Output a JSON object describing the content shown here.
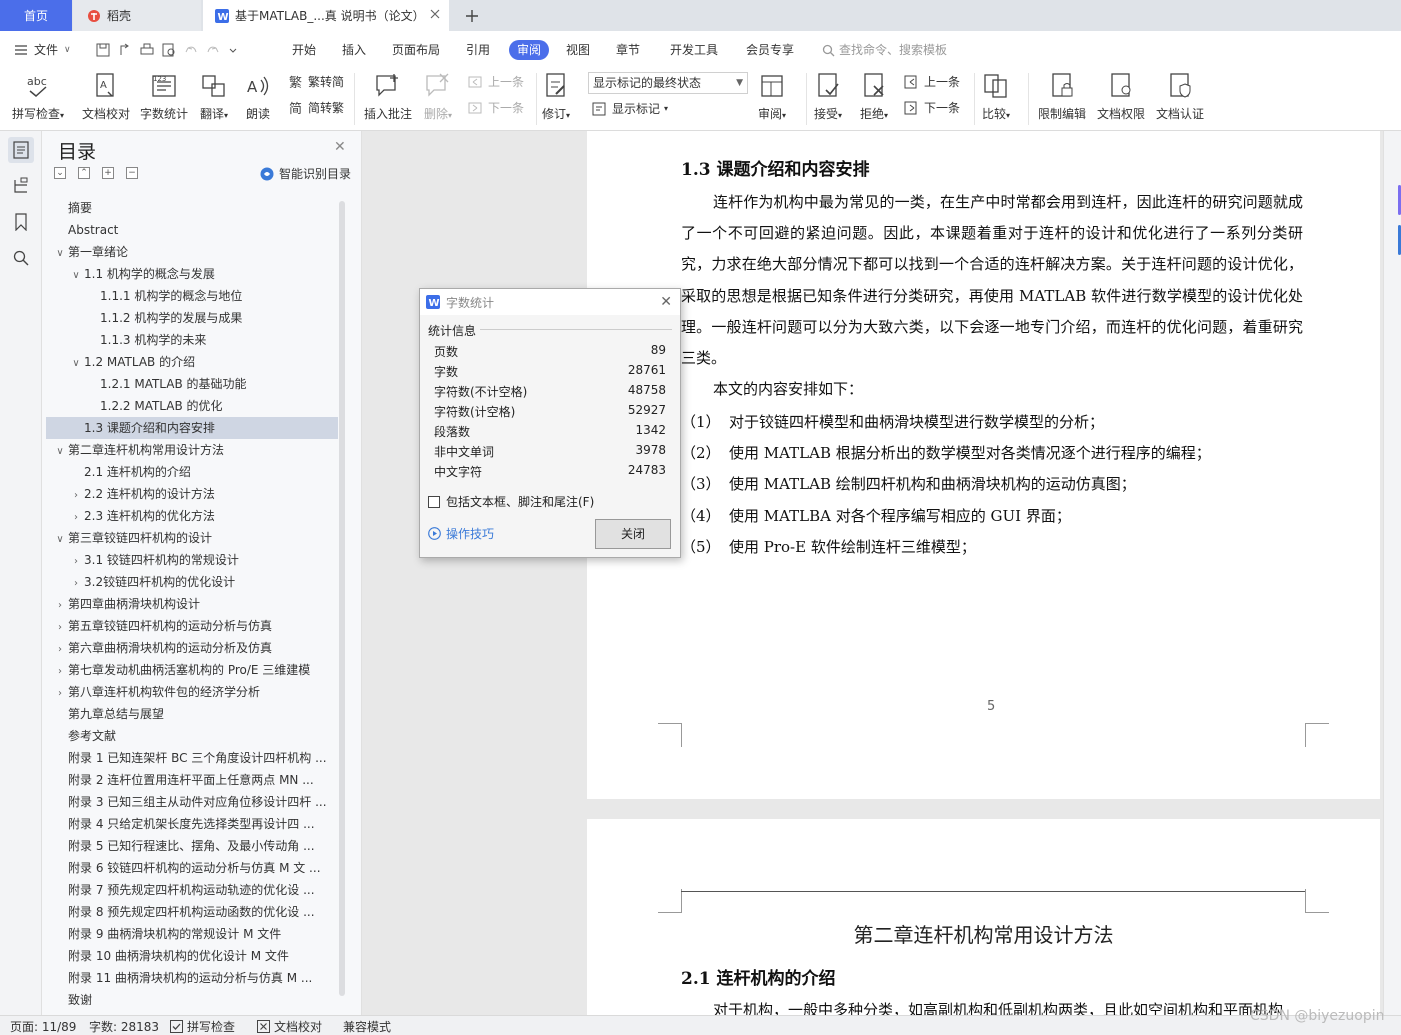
{
  "tabs": {
    "home": "首页",
    "daoke": "稻壳",
    "doc": "基于MATLAB_...真 说明书（论文）"
  },
  "menu": {
    "file": "文件",
    "items": [
      "开始",
      "插入",
      "页面布局",
      "引用",
      "审阅",
      "视图",
      "章节",
      "开发工具",
      "会员专享"
    ],
    "search": "查找命令、搜索模板"
  },
  "ribbon": {
    "spell": "拼写检查",
    "proof": "文档校对",
    "wordcount": "字数统计",
    "translate": "翻译",
    "read": "朗读",
    "trad": "繁转简",
    "simp": "简转繁",
    "insert_comment": "插入批注",
    "delete": "删除",
    "prev": "上一条",
    "next": "下一条",
    "revise": "修订",
    "markup_select": "显示标记的最终状态",
    "show_markup": "显示标记",
    "review": "审阅",
    "accept": "接受",
    "reject": "拒绝",
    "prev2": "上一条",
    "next2": "下一条",
    "compare": "比较",
    "restrict": "限制编辑",
    "rights": "文档权限",
    "auth": "文档认证"
  },
  "toc": {
    "title": "目录",
    "smart": "智能识别目录",
    "items": [
      {
        "text": "摘要",
        "level": 0,
        "tw": ""
      },
      {
        "text": "Abstract",
        "level": 0,
        "tw": ""
      },
      {
        "text": "第一章绪论",
        "level": 0,
        "tw": "v"
      },
      {
        "text": "1.1  机构学的概念与发展",
        "level": 1,
        "tw": "v"
      },
      {
        "text": "1.1.1 机构学的概念与地位",
        "level": 2,
        "tw": ""
      },
      {
        "text": "1.1.2  机构学的发展与成果",
        "level": 2,
        "tw": ""
      },
      {
        "text": "1.1.3  机构学的未来",
        "level": 2,
        "tw": ""
      },
      {
        "text": "1.2 MATLAB 的介绍",
        "level": 1,
        "tw": "v"
      },
      {
        "text": "1.2.1 MATLAB 的基础功能",
        "level": 2,
        "tw": ""
      },
      {
        "text": "1.2.2 MATLAB 的优化",
        "level": 2,
        "tw": ""
      },
      {
        "text": "1.3  课题介绍和内容安排",
        "level": 1,
        "tw": "",
        "sel": true
      },
      {
        "text": "第二章连杆机构常用设计方法",
        "level": 0,
        "tw": "v"
      },
      {
        "text": "2.1  连杆机构的介绍",
        "level": 1,
        "tw": ""
      },
      {
        "text": "2.2 连杆机构的设计方法",
        "level": 1,
        "tw": ">"
      },
      {
        "text": "2.3  连杆机构的优化方法",
        "level": 1,
        "tw": ">"
      },
      {
        "text": "第三章铰链四杆机构的设计",
        "level": 0,
        "tw": "v"
      },
      {
        "text": "3.1  铰链四杆机构的常规设计",
        "level": 1,
        "tw": ">"
      },
      {
        "text": "3.2铰链四杆机构的优化设计",
        "level": 1,
        "tw": ">"
      },
      {
        "text": "第四章曲柄滑块机构设计",
        "level": 0,
        "tw": ">"
      },
      {
        "text": "第五章铰链四杆机构的运动分析与仿真",
        "level": 0,
        "tw": ">"
      },
      {
        "text": "第六章曲柄滑块机构的运动分析及仿真",
        "level": 0,
        "tw": ">"
      },
      {
        "text": "第七章发动机曲柄活塞机构的 Pro/E 三维建模",
        "level": 0,
        "tw": ">"
      },
      {
        "text": "第八章连杆机构软件包的经济学分析",
        "level": 0,
        "tw": ">"
      },
      {
        "text": "第九章总结与展望",
        "level": 0,
        "tw": ""
      },
      {
        "text": "参考文献",
        "level": 0,
        "tw": ""
      },
      {
        "text": "附录 1 已知连架杆 BC 三个角度设计四杆机构 ...",
        "level": 0,
        "tw": ""
      },
      {
        "text": "附录 2  连杆位置用连杆平面上任意两点 MN ...",
        "level": 0,
        "tw": ""
      },
      {
        "text": "附录 3 已知三组主从动件对应角位移设计四杆 ...",
        "level": 0,
        "tw": ""
      },
      {
        "text": "附录 4  只给定机架长度先选择类型再设计四 ...",
        "level": 0,
        "tw": ""
      },
      {
        "text": "附录 5  已知行程速比、摆角、及最小传动角 ...",
        "level": 0,
        "tw": ""
      },
      {
        "text": "附录 6  铰链四杆机构的运动分析与仿真 M 文 ...",
        "level": 0,
        "tw": ""
      },
      {
        "text": "附录 7  预先规定四杆机构运动轨迹的优化设 ...",
        "level": 0,
        "tw": ""
      },
      {
        "text": "附录 8  预先规定四杆机构运动函数的优化设 ...",
        "level": 0,
        "tw": ""
      },
      {
        "text": "附录 9  曲柄滑块机构的常规设计 M 文件",
        "level": 0,
        "tw": ""
      },
      {
        "text": "附录 10  曲柄滑块机构的优化设计 M 文件",
        "level": 0,
        "tw": ""
      },
      {
        "text": "附录 11  曲柄滑块机构的运动分析与仿真 M ...",
        "level": 0,
        "tw": ""
      },
      {
        "text": "致谢",
        "level": 0,
        "tw": ""
      }
    ]
  },
  "doc": {
    "h13": "1.3  课题介绍和内容安排",
    "p1": "连杆作为机构中最为常见的一类，在生产中时常都会用到连杆，因此连杆的研究问题就成了一个不可回避的紧迫问题。因此，本课题着重对于连杆的设计和优化进行了一系列分类研究，力求在绝大部分情况下都可以找到一个合适的连杆解决方案。关于连杆问题的设计优化，采取的思想是根据已知条件进行分类研究，再使用 MATLAB 软件进行数学模型的设计优化处理。一般连杆问题可以分为大致六类，以下会逐一地专门介绍，而连杆的优化问题，着重研究三类。",
    "p2": "本文的内容安排如下：",
    "list": [
      {
        "n": "（1）",
        "t": "对于铰链四杆模型和曲柄滑块模型进行数学模型的分析；"
      },
      {
        "n": "（2）",
        "t": "使用 MATLAB 根据分析出的数学模型对各类情况逐个进行程序的编程；"
      },
      {
        "n": "（3）",
        "t": "使用 MATLAB 绘制四杆机构和曲柄滑块机构的运动仿真图；"
      },
      {
        "n": "（4）",
        "t": "使用 MATLBA 对各个程序编写相应的 GUI 界面；"
      },
      {
        "n": "（5）",
        "t": "使用 Pro-E 软件绘制连杆三维模型；"
      }
    ],
    "page_number": "5",
    "ch2": "第二章连杆机构常用设计方法",
    "h21": "2.1  连杆机构的介绍",
    "p3": "对于机构，一般中多种分类，如高副机构和低副机构两类，且此如空间机构和平面机构"
  },
  "dialog": {
    "title": "字数统计",
    "section": "统计信息",
    "stats": [
      {
        "label": "页数",
        "value": "89"
      },
      {
        "label": "字数",
        "value": "28761"
      },
      {
        "label": "字符数(不计空格)",
        "value": "48758"
      },
      {
        "label": "字符数(计空格)",
        "value": "52927"
      },
      {
        "label": "段落数",
        "value": "1342"
      },
      {
        "label": "非中文单词",
        "value": "3978"
      },
      {
        "label": "中文字符",
        "value": "24783"
      }
    ],
    "checkbox": "包括文本框、脚注和尾注(F)",
    "tips": "操作技巧",
    "close": "关闭"
  },
  "status": {
    "page": "页面: 11/89",
    "words": "字数: 28183",
    "spell": "拼写检查",
    "proof": "文档校对",
    "compat": "兼容模式"
  },
  "watermark": "CSDN @biyezuopin",
  "colors": {
    "accent": "#4b6eea",
    "link": "#3a7ad8"
  }
}
